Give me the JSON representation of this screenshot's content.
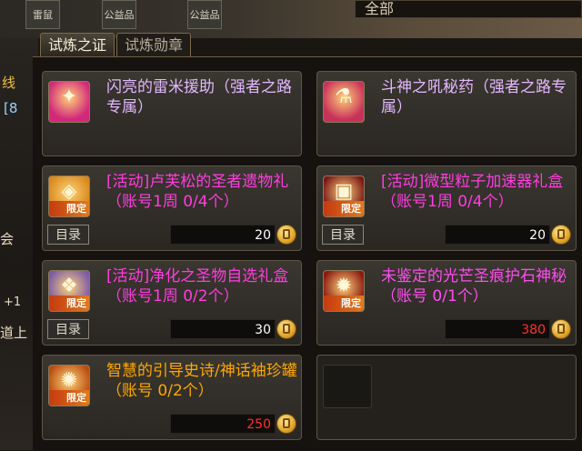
{
  "side_text": {
    "line1": "线",
    "line2": "[8",
    "line3": "会",
    "line4": "+1",
    "line5": "道上"
  },
  "top_buttons": [
    "雷鼠",
    "公益品",
    "公益品"
  ],
  "filter": {
    "selected": "全部"
  },
  "tabs": [
    {
      "label": "试炼之证",
      "active": true
    },
    {
      "label": "试炼勋章",
      "active": false
    }
  ],
  "catalog_label": "目录",
  "items": [
    {
      "name": "闪亮的雷米援助（强者之路专属）",
      "name_color": "#e3b8ff",
      "limited": false,
      "price": "",
      "price_color": "#ffffff",
      "has_catalog": false,
      "icon_color": "#d1287a",
      "icon_glyph": "✦",
      "icon_name": "gift-box-icon"
    },
    {
      "name": "斗神之吼秘药（强者之路专属）",
      "name_color": "#e3b8ff",
      "limited": false,
      "price": "",
      "price_color": "#ffffff",
      "has_catalog": false,
      "icon_color": "#c8325a",
      "icon_glyph": "⚗",
      "icon_name": "potion-icon"
    },
    {
      "name": "[活动]卢芙松的圣者遗物礼（账号1周 0/4个）",
      "name_color": "#ff3de0",
      "limited": true,
      "limited_label": "限定",
      "price": "20",
      "price_color": "#ffffff",
      "has_catalog": true,
      "icon_color": "#d9881a",
      "icon_glyph": "◈",
      "icon_name": "gift-box-icon"
    },
    {
      "name": "[活动]微型粒子加速器礼盒（账号1周 0/4个）",
      "name_color": "#ff3de0",
      "limited": true,
      "limited_label": "限定",
      "price": "20",
      "price_color": "#ffffff",
      "has_catalog": true,
      "icon_color": "#7a1818",
      "icon_glyph": "▣",
      "icon_name": "box-icon"
    },
    {
      "name": "[活动]净化之圣物自选礼盒（账号1周 0/2个）",
      "name_color": "#ff3de0",
      "limited": true,
      "limited_label": "限定",
      "price": "30",
      "price_color": "#ffffff",
      "has_catalog": true,
      "icon_color": "#7a5aa6",
      "icon_glyph": "❖",
      "icon_name": "relic-box-icon"
    },
    {
      "name": "未鉴定的光芒圣痕护石神秘（账号 0/1个）",
      "name_color": "#ff4df0",
      "limited": true,
      "limited_label": "限定",
      "price": "380",
      "price_color": "#ff3030",
      "has_catalog": false,
      "icon_color": "#8a1a10",
      "icon_glyph": "✹",
      "icon_name": "stone-icon"
    },
    {
      "name": "智慧的引导史诗/神话袖珍罐（账号 0/2个）",
      "name_color": "#ffa800",
      "limited": true,
      "limited_label": "限定",
      "price": "250",
      "price_color": "#ff3030",
      "has_catalog": false,
      "icon_color": "#b84c10",
      "icon_glyph": "✺",
      "icon_name": "jar-icon"
    },
    {
      "name": "",
      "empty": true
    }
  ]
}
